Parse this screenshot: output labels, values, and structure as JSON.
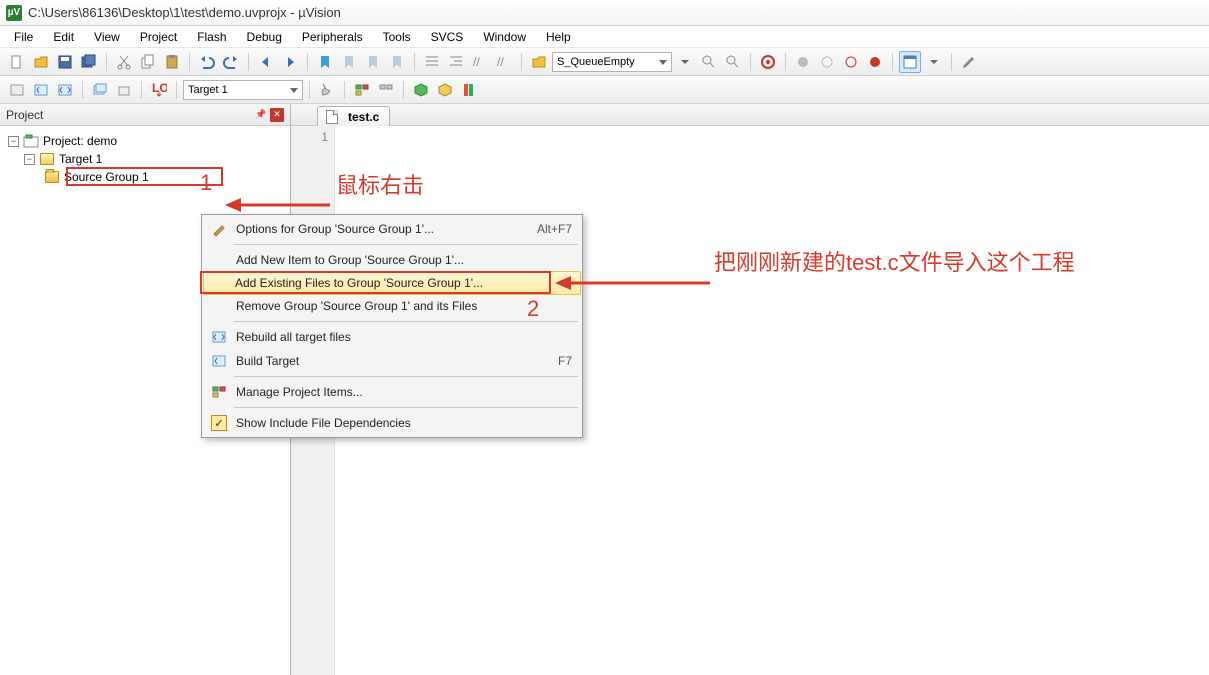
{
  "title": {
    "path": "C:\\Users\\86136\\Desktop\\1\\test\\demo.uvprojx - µVision",
    "icon": "µV"
  },
  "menu": [
    "File",
    "Edit",
    "View",
    "Project",
    "Flash",
    "Debug",
    "Peripherals",
    "Tools",
    "SVCS",
    "Window",
    "Help"
  ],
  "toolbar1": {
    "combo": "S_QueueEmpty"
  },
  "toolbar2": {
    "target_combo": "Target 1"
  },
  "project_panel": {
    "title": "Project",
    "root": "Project: demo",
    "target": "Target 1",
    "group": "Source Group 1"
  },
  "editor": {
    "tab": "test.c",
    "line_number": "1"
  },
  "context_menu": {
    "items": [
      {
        "label": "Options for Group 'Source Group 1'...",
        "shortcut": "Alt+F7",
        "icon": "magic"
      },
      {
        "sep": true
      },
      {
        "label": "Add New  Item to Group 'Source Group 1'..."
      },
      {
        "label": "Add Existing Files to Group 'Source Group 1'...",
        "highlight": true
      },
      {
        "label": "Remove Group 'Source Group 1' and its Files"
      },
      {
        "sep": true
      },
      {
        "label": "Rebuild all target files",
        "icon": "rebuild"
      },
      {
        "label": "Build Target",
        "shortcut": "F7",
        "icon": "build"
      },
      {
        "sep": true
      },
      {
        "label": "Manage Project Items...",
        "icon": "manage"
      },
      {
        "sep": true
      },
      {
        "label": "Show Include File Dependencies",
        "icon": "check"
      }
    ]
  },
  "annotations": {
    "n1": "1",
    "right_click": "鼠标右击",
    "n2": "2",
    "import_line": "把刚刚新建的test.c文件导入这个工程"
  }
}
